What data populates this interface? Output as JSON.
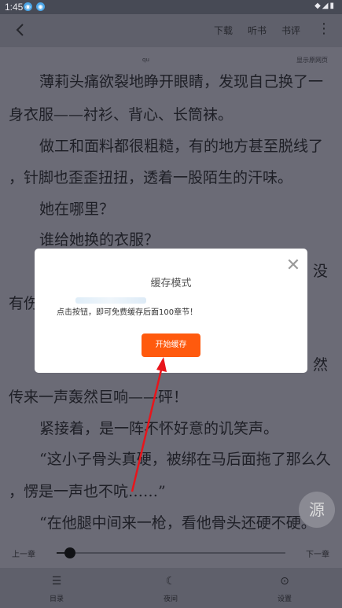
{
  "status_bar": {
    "time": "1:45",
    "icons": [
      "signal-icon",
      "wifi-icon",
      "battery-icon"
    ]
  },
  "top_bar": {
    "download": "下载",
    "listen": "听书",
    "review": "书评"
  },
  "reader": {
    "header_left": "qu",
    "header_right": "显示原网页",
    "lines": [
      "薄莉头痛欲裂地睁开眼睛，发现自己换了一",
      "身衣服——衬衫、背心、长筒袜。",
      "做工和面料都很粗糙，有的地方甚至脱线了",
      "，针脚也歪歪扭扭，透着一股陌生的汗味。",
      "她在哪里？",
      "谁给她换的衣服？",
      "没",
      "有伤",
      "然",
      "传来一声轰然巨响——砰！",
      "紧接着，是一阵不怀好意的讥笑声。",
      "“这小子骨头真硬，被绑在马后面拖了那么久",
      "，愣是一声也不吭……”",
      "“在他腿中间来一枪，看他骨头还硬不硬。"
    ]
  },
  "dialog": {
    "title": "缓存模式",
    "message": "点击按钮，即可免费缓存后面100章节！",
    "button": "开始缓存"
  },
  "source_button": "源",
  "progress": {
    "prev": "上一章",
    "next": "下一章",
    "value": 0.06
  },
  "bottom_tabs": [
    {
      "label": "目录",
      "icon": "menu-icon"
    },
    {
      "label": "夜间",
      "icon": "moon-icon"
    },
    {
      "label": "设置",
      "icon": "settings-icon"
    }
  ],
  "colors": {
    "accent": "#ff5a0e",
    "overlay": "#6b6b76",
    "annotation": "#e8151b"
  }
}
